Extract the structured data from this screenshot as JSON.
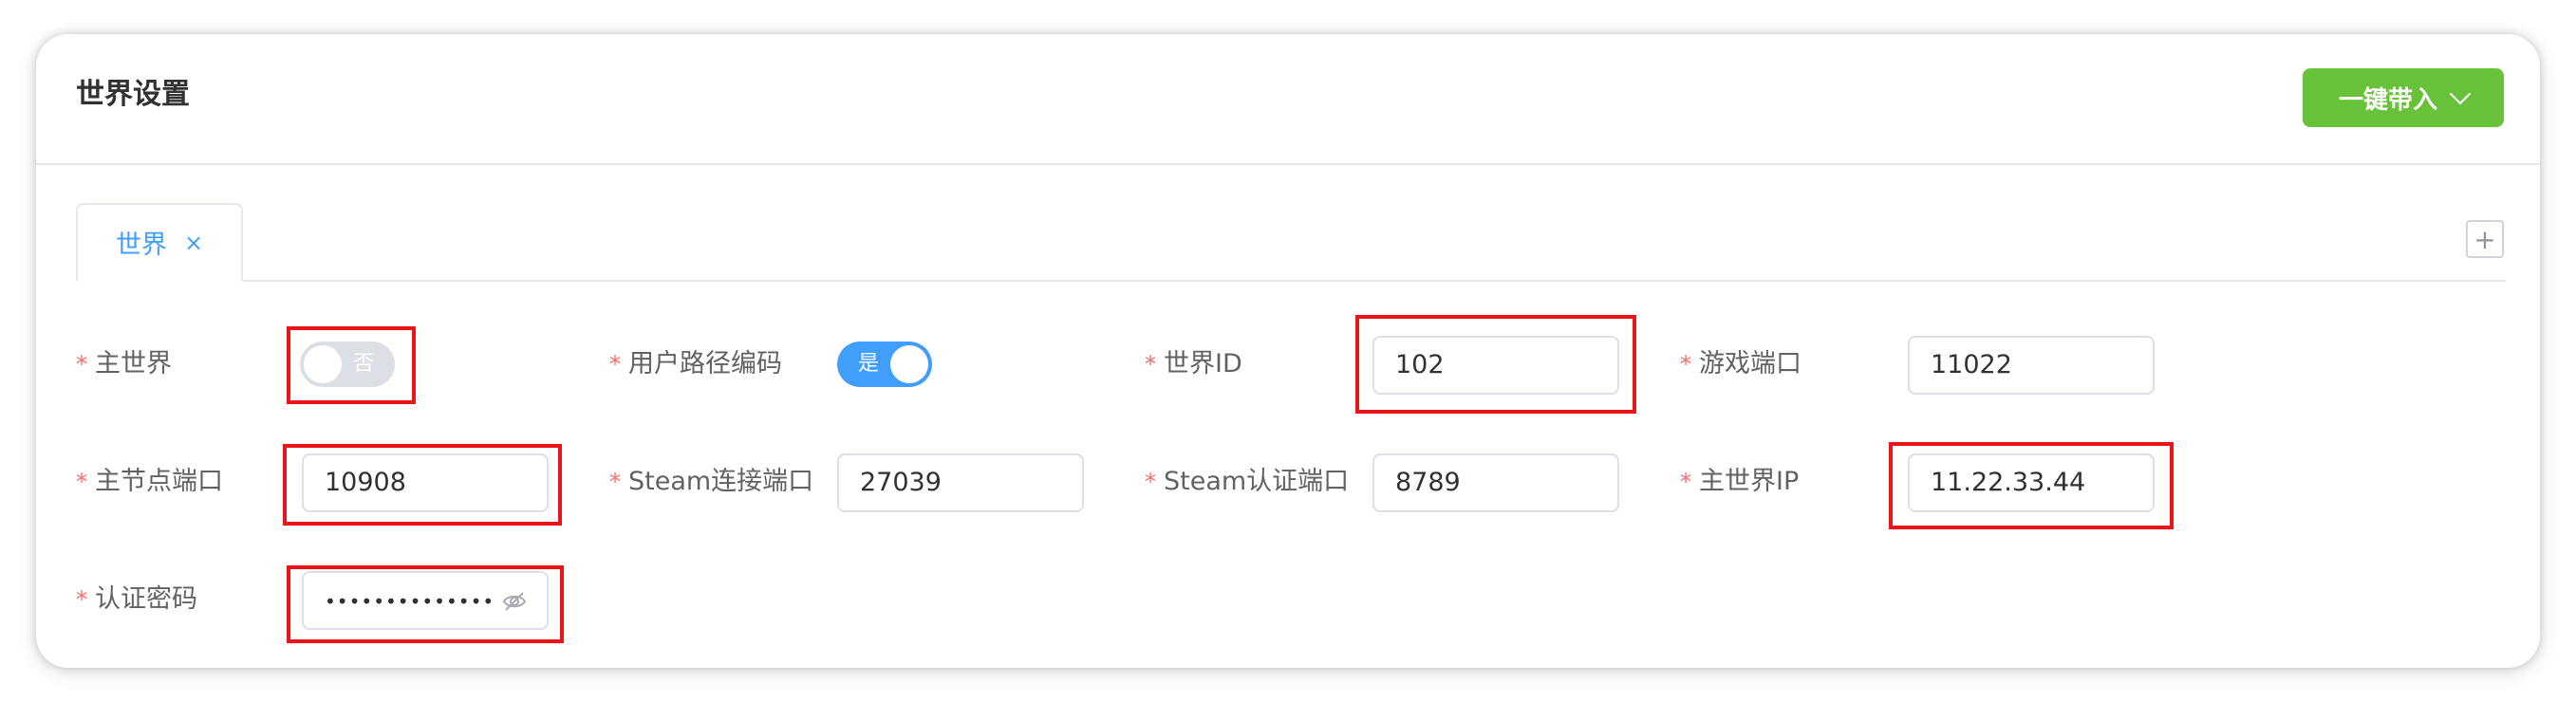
{
  "header": {
    "title": "世界设置",
    "import_button": "一键带入"
  },
  "tabs": [
    {
      "label": "世界",
      "close": "×"
    }
  ],
  "add_tab": "+",
  "form": {
    "main_world": {
      "label": "主世界",
      "value": "否",
      "on": false
    },
    "user_path_encoding": {
      "label": "用户路径编码",
      "value": "是",
      "on": true
    },
    "world_id": {
      "label": "世界ID",
      "value": "102"
    },
    "game_port": {
      "label": "游戏端口",
      "value": "11022"
    },
    "master_node_port": {
      "label": "主节点端口",
      "value": "10908"
    },
    "steam_connect_port": {
      "label": "Steam连接端口",
      "value": "27039"
    },
    "steam_auth_port": {
      "label": "Steam认证端口",
      "value": "8789"
    },
    "main_world_ip": {
      "label": "主世界IP",
      "value": "11.22.33.44"
    },
    "auth_password": {
      "label": "认证密码",
      "value": "••••••••••••••"
    }
  },
  "required_mark": "*",
  "colors": {
    "primary": "#409eff",
    "success": "#67c23a",
    "danger": "#f56c6c",
    "highlight": "#e8151b"
  }
}
